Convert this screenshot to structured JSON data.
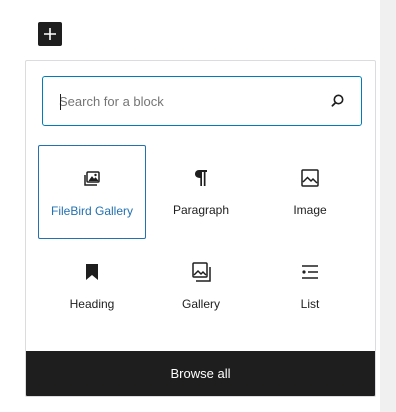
{
  "toolbar": {
    "add_block_icon": "plus-icon"
  },
  "search": {
    "placeholder": "Search for a block",
    "value": "",
    "icon": "search-icon"
  },
  "blocks": [
    {
      "label": "FileBird Gallery",
      "icon": "filebird-gallery-icon",
      "selected": true
    },
    {
      "label": "Paragraph",
      "icon": "paragraph-icon"
    },
    {
      "label": "Image",
      "icon": "image-icon"
    },
    {
      "label": "Heading",
      "icon": "heading-bookmark-icon"
    },
    {
      "label": "Gallery",
      "icon": "gallery-icon"
    },
    {
      "label": "List",
      "icon": "list-icon"
    }
  ],
  "footer": {
    "browse_all_label": "Browse all"
  },
  "colors": {
    "accent": "#2271b1",
    "focus": "#007cba",
    "dark": "#1e1e1e"
  }
}
